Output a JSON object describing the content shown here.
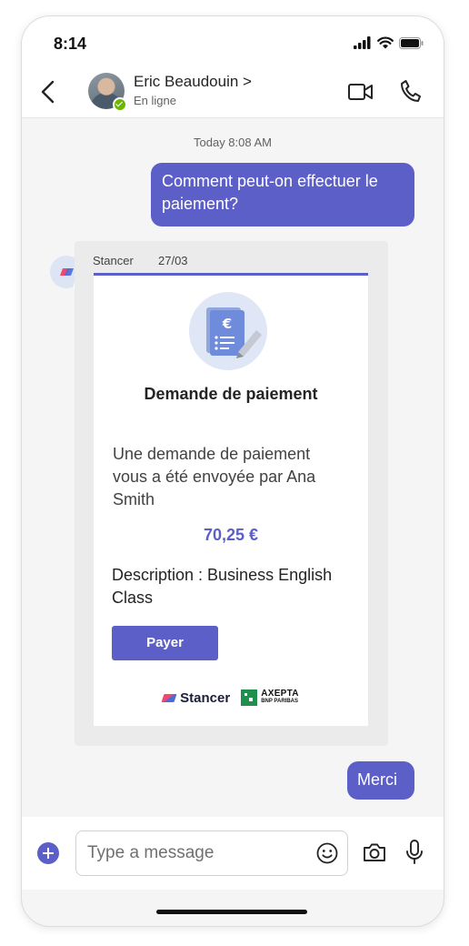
{
  "status_bar": {
    "time": "8:14"
  },
  "header": {
    "contact_name": "Eric Beaudouin >",
    "contact_status": "En ligne",
    "icons": [
      "back-chevron-icon",
      "video-call-icon",
      "phone-call-icon"
    ]
  },
  "conversation": {
    "timestamp": "Today 8:08 AM",
    "outgoing_1": "Comment peut-on effectuer le paiement?",
    "card": {
      "sender": "Stancer",
      "date": "27/03",
      "title": "Demande de paiement",
      "body": "Une demande de paiement vous a été envoyée par Ana Smith",
      "amount": "70,25 €",
      "description": "Description : Business English Class",
      "button_label": "Payer",
      "logos": {
        "stancer": "Stancer",
        "axepta": "AXEPTA",
        "axepta_sub": "BNP PARIBAS"
      }
    },
    "outgoing_2": "Merci"
  },
  "composer": {
    "placeholder": "Type a message"
  },
  "colors": {
    "accent": "#5b5fc7",
    "presence": "#6bb700",
    "chat_background": "#f5f5f5"
  }
}
